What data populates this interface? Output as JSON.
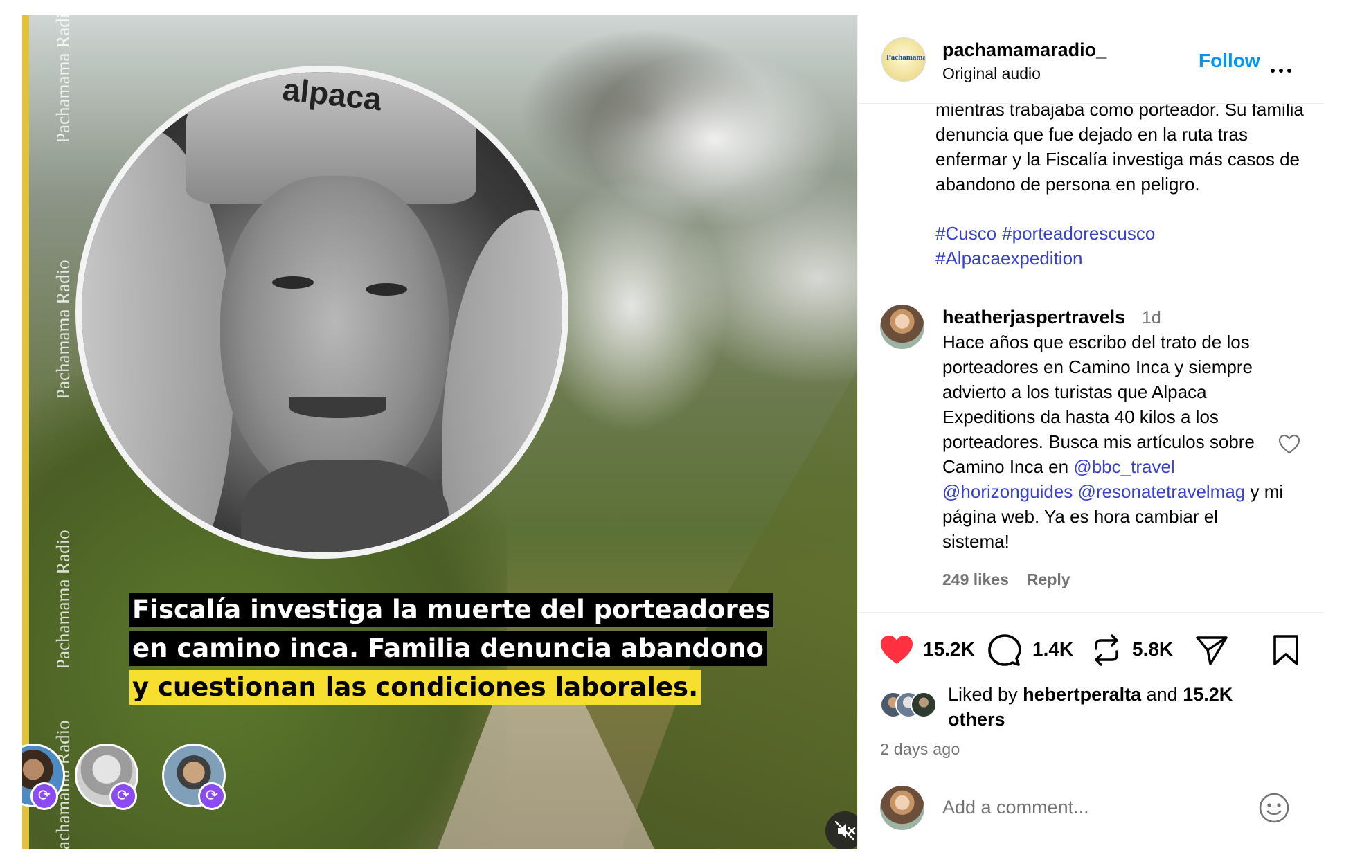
{
  "media": {
    "watermark": "Pachamama Radio",
    "portrait_cap_text": "alpaca",
    "caption_lines": [
      "Fiscalía investiga la muerte del porteadores",
      "en camino inca. Familia denuncia abandono",
      "y cuestionan las condiciones laborales."
    ],
    "caption_highlight_color": "#f7df2f",
    "remix_icon": "remix-icon",
    "mute_icon": "speaker-muted-icon"
  },
  "header": {
    "username": "pachamamaradio_",
    "subtitle": "Original audio",
    "follow_label": "Follow",
    "logo_text": "Pachamama",
    "more_icon": "more-options-icon"
  },
  "post": {
    "text": "mientras trabajaba como porteador. Su familia denuncia que fue dejado en la ruta tras enfermar y la Fiscalía investiga más casos de abandono de persona en peligro.",
    "hashtags": [
      "#Cusco",
      "#porteadorescusco",
      "#Alpacaexpedition"
    ]
  },
  "comment": {
    "username": "heatherjaspertravels",
    "time": "1d",
    "text_parts": [
      "Hace años que escribo del trato de los porteadores en Camino Inca y siempre advierto a los turistas que Alpaca Expeditions da hasta 40 kilos a los porteadores. Busca mis artículos sobre Camino Inca en ",
      " y mi página web. Ya es hora cambiar el sistema!"
    ],
    "mentions": [
      "@bbc_travel",
      "@horizonguides",
      "@resonatetravelmag"
    ],
    "likes_label": "249 likes",
    "reply_label": "Reply"
  },
  "actions": {
    "like_count": "15.2K",
    "comment_count": "1.4K",
    "repost_count": "5.8K",
    "liked_prefix": "Liked by ",
    "liked_user": "hebertperalta",
    "liked_and": " and ",
    "liked_others": "15.2K others",
    "time_ago": "2 days ago",
    "like_color": "#ff3040",
    "link_color": "#3742c8",
    "follow_color": "#0095f6"
  },
  "add_comment": {
    "placeholder": "Add a comment...",
    "emoji_icon": "emoji-icon"
  }
}
